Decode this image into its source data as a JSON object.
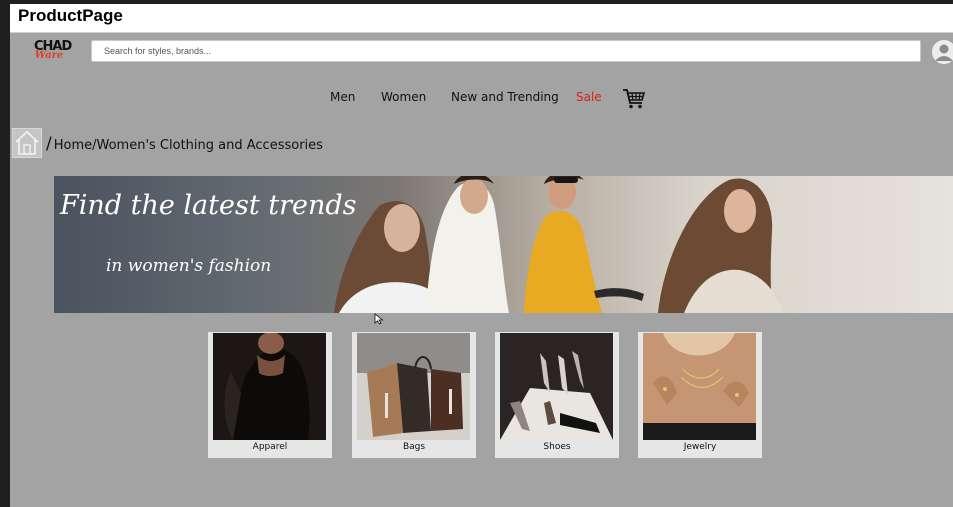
{
  "window": {
    "title": "ProductPage"
  },
  "header": {
    "logo_top": "CHAD",
    "logo_bottom": "Ware",
    "search_placeholder": "Search for styles, brands..."
  },
  "nav": {
    "items": [
      {
        "label": "Men"
      },
      {
        "label": "Women"
      },
      {
        "label": "New and Trending"
      },
      {
        "label": "Sale",
        "color": "#e0201b"
      }
    ],
    "cart_icon": "shopping-cart-icon"
  },
  "breadcrumb": {
    "home_icon": "home-icon",
    "separator": "/",
    "path": "Home/Women's Clothing and Accessories"
  },
  "banner": {
    "line1": "Find the latest trends",
    "line2": "in women's fashion"
  },
  "categories": [
    {
      "label": "Apparel"
    },
    {
      "label": "Bags"
    },
    {
      "label": "Shoes"
    },
    {
      "label": "Jewelry"
    }
  ],
  "colors": {
    "background": "#a3a3a3",
    "sale": "#e0201b",
    "logo_accent": "#e13b2c"
  }
}
